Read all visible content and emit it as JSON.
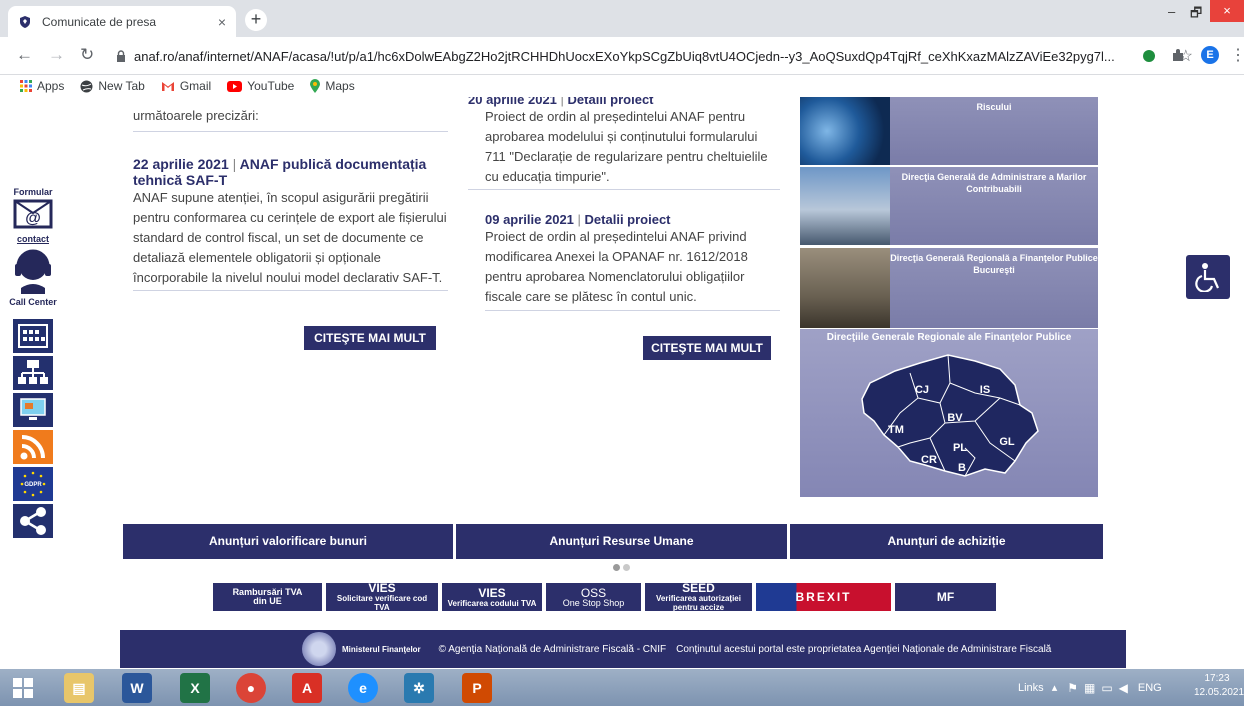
{
  "browser": {
    "tab_title": "Comunicate de presa",
    "tab_close": "×",
    "new_tab": "+",
    "url": "anaf.ro/anaf/internet/ANAF/acasa/!ut/p/a1/hc6xDolwEAbgZ2Ho2jtRCHHDhUocxEXoYkpSCgZbUiq8vtU4OCjedn--y3_AoQSuxdQp4TqjRf_ceXhKxazMAlzZAViEe32pyg7l...",
    "profile_initial": "E",
    "min": "–",
    "max": "🗗",
    "close": "×"
  },
  "bookmarks": [
    {
      "label": "Apps",
      "icon": "apps-grid-icon"
    },
    {
      "label": "New Tab",
      "icon": "globe-icon"
    },
    {
      "label": "Gmail",
      "icon": "gmail-icon"
    },
    {
      "label": "YouTube",
      "icon": "youtube-icon"
    },
    {
      "label": "Maps",
      "icon": "maps-pin-icon"
    }
  ],
  "sidebar": {
    "formular_label": "Formular",
    "contact_label": "contact",
    "call_center_label": "Call Center",
    "icons": [
      "calendar-grid-icon",
      "org-chart-icon",
      "monitor-icon",
      "rss-icon",
      "gdpr-icon",
      "share-icon"
    ]
  },
  "news_left": {
    "intro_line": "următoarele precizări:",
    "item_date": "22 aprilie 2021",
    "item_sep": "|",
    "item_title": "ANAF publică documentația tehnică SAF-T",
    "item_body": "ANAF supune atenției, în scopul asigurării pregătirii pentru conformarea cu cerințele de export ale fișierului standard de control fiscal, un set de documente ce detaliază elementele obligatorii și opționale încorporabile la nivelul noului model declarativ SAF-T.",
    "read_more": "CITEŞTE MAI MULT"
  },
  "news_right": {
    "top_date": "20 aprilie 2021",
    "top_link": "Detalii proiect",
    "top_body": "Proiect de ordin al președintelui ANAF pentru aprobarea modelului și conținutului formularului 711 \"Declarație de regularizare pentru cheltuielile cu educația timpurie\".",
    "item_date": "09 aprilie 2021",
    "item_sep": "|",
    "item_link": "Detalii proiect",
    "item_body": "Proiect de ordin al președintelui ANAF privind modificarea Anexei la OPANAF nr. 1612/2018 pentru aprobarea Nomenclatorului obligațiilor fiscale care se plătesc în contul unic.",
    "read_more": "CITEŞTE MAI MULT"
  },
  "right_panel": {
    "row1": "Riscului",
    "row2": "Direcţia Generală de Administrare a Marilor Contribuabili",
    "row3": "Direcţia Generală Regională a Finanţelor Publice Bucureşti",
    "map_title": "Direcţiile Generale Regionale ale Finanţelor Publice",
    "regions": [
      "CJ",
      "IS",
      "BV",
      "TM",
      "GL",
      "PL",
      "CR",
      "B"
    ]
  },
  "anunturi": [
    "Anunțuri valorificare bunuri",
    "Anunțuri Resurse Umane",
    "Anunțuri de achiziție"
  ],
  "banners": [
    {
      "l1": "Rambursări TVA",
      "l2": "din UE"
    },
    {
      "l1": "VIES",
      "l2": "Solicitare verificare cod TVA"
    },
    {
      "l1": "VIES",
      "l2": "Verificarea codului TVA"
    },
    {
      "l1": "OSS",
      "l2": "One Stop Shop"
    },
    {
      "l1": "SEED",
      "l2": "Verificarea autorizației pentru accize"
    },
    {
      "l1": "BREXIT",
      "l2": ""
    },
    {
      "l1": "MF",
      "l2": ""
    }
  ],
  "footer": {
    "ministry": "Ministerul Finanţelor",
    "copyright": "© Agenţia Naţională de Administrare Fiscală - CNIF",
    "ownership": "Conţinutul acestui portal este proprietatea Agenţiei Naţionale de Administrare Fiscală"
  },
  "taskbar": {
    "links": "Links",
    "lang": "ENG",
    "time": "17:23",
    "date": "12.05.2021"
  },
  "colors": {
    "brand": "#2c2f6b",
    "panel": "#8486b4"
  }
}
